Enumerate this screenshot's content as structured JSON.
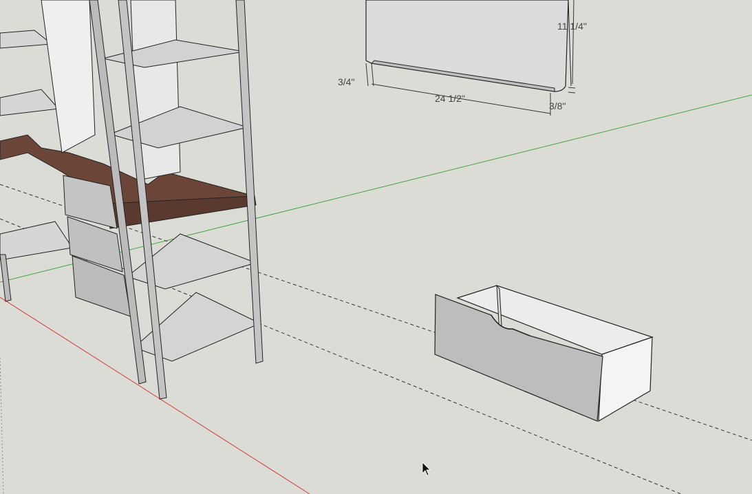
{
  "app": {
    "view": "3D modeling viewport"
  },
  "colors": {
    "background": "#dcdcd7",
    "red_axis": "#d23a2e",
    "green_axis": "#3caa3c",
    "wood": "#6a4538",
    "panel": "#e2e2e2",
    "shelf": "#d4d4d4",
    "drawer_front": "#bdbdbd"
  },
  "icons": {
    "cursor": "arrow-cursor-icon"
  },
  "dimensions": {
    "height": "11 1/4\"",
    "thickness": "3/4\"",
    "width": "24 1/2\"",
    "gap": "3/8\""
  }
}
